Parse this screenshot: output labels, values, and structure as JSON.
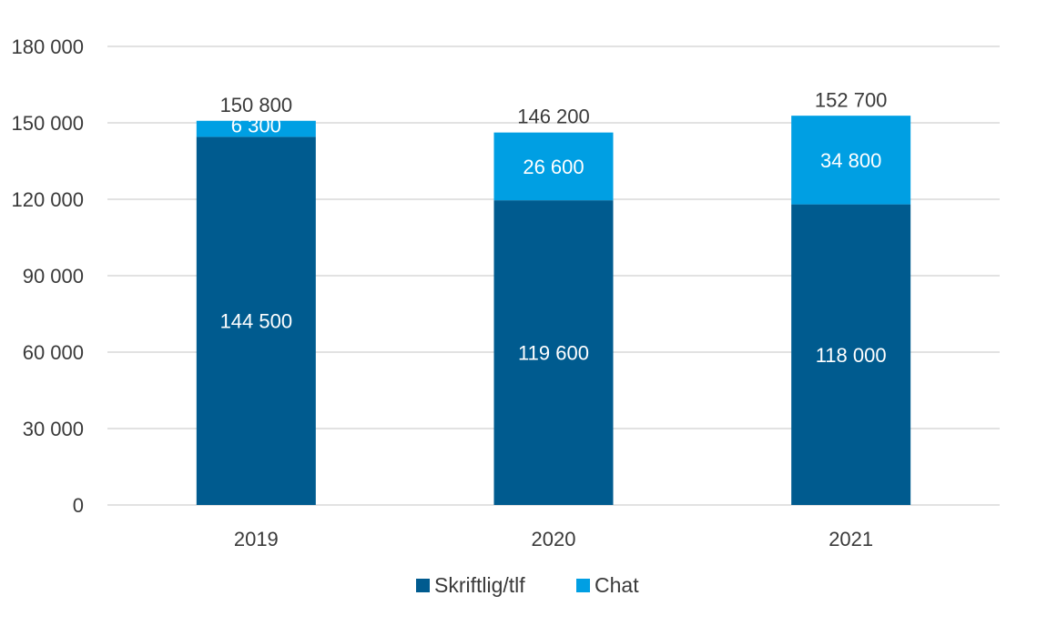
{
  "chart_data": {
    "type": "bar",
    "stacked": true,
    "title": "",
    "xlabel": "",
    "ylabel": "",
    "categories": [
      "2019",
      "2020",
      "2021"
    ],
    "series": [
      {
        "name": "Skriftlig/tlf",
        "color": "#005b8f",
        "values": [
          144500,
          119600,
          118000
        ],
        "labels": [
          "144 500",
          "119 600",
          "118 000"
        ]
      },
      {
        "name": "Chat",
        "color": "#009fe3",
        "values": [
          6300,
          26600,
          34800
        ],
        "labels": [
          "6 300",
          "26 600",
          "34 800"
        ]
      }
    ],
    "totals": [
      150800,
      146200,
      152700
    ],
    "total_labels": [
      "150 800",
      "146 200",
      "152 700"
    ],
    "ylim": [
      0,
      180000
    ],
    "yticks": [
      0,
      30000,
      60000,
      90000,
      120000,
      150000,
      180000
    ],
    "ytick_labels": [
      "0",
      "30 000",
      "60 000",
      "90 000",
      "120 000",
      "150 000",
      "180 000"
    ],
    "grid": true,
    "legend_position": "bottom-center"
  }
}
